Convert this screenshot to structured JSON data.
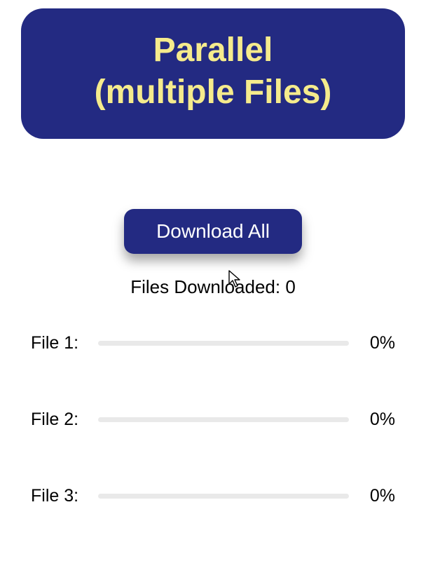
{
  "header": {
    "title_line1": "Parallel",
    "title_line2": "(multiple Files)"
  },
  "button": {
    "download_all_label": "Download All"
  },
  "status": {
    "downloaded_prefix": "Files Downloaded: ",
    "downloaded_count": "0"
  },
  "files": [
    {
      "label": "File 1:",
      "percent": "0%"
    },
    {
      "label": "File 2:",
      "percent": "0%"
    },
    {
      "label": "File 3:",
      "percent": "0%"
    }
  ]
}
